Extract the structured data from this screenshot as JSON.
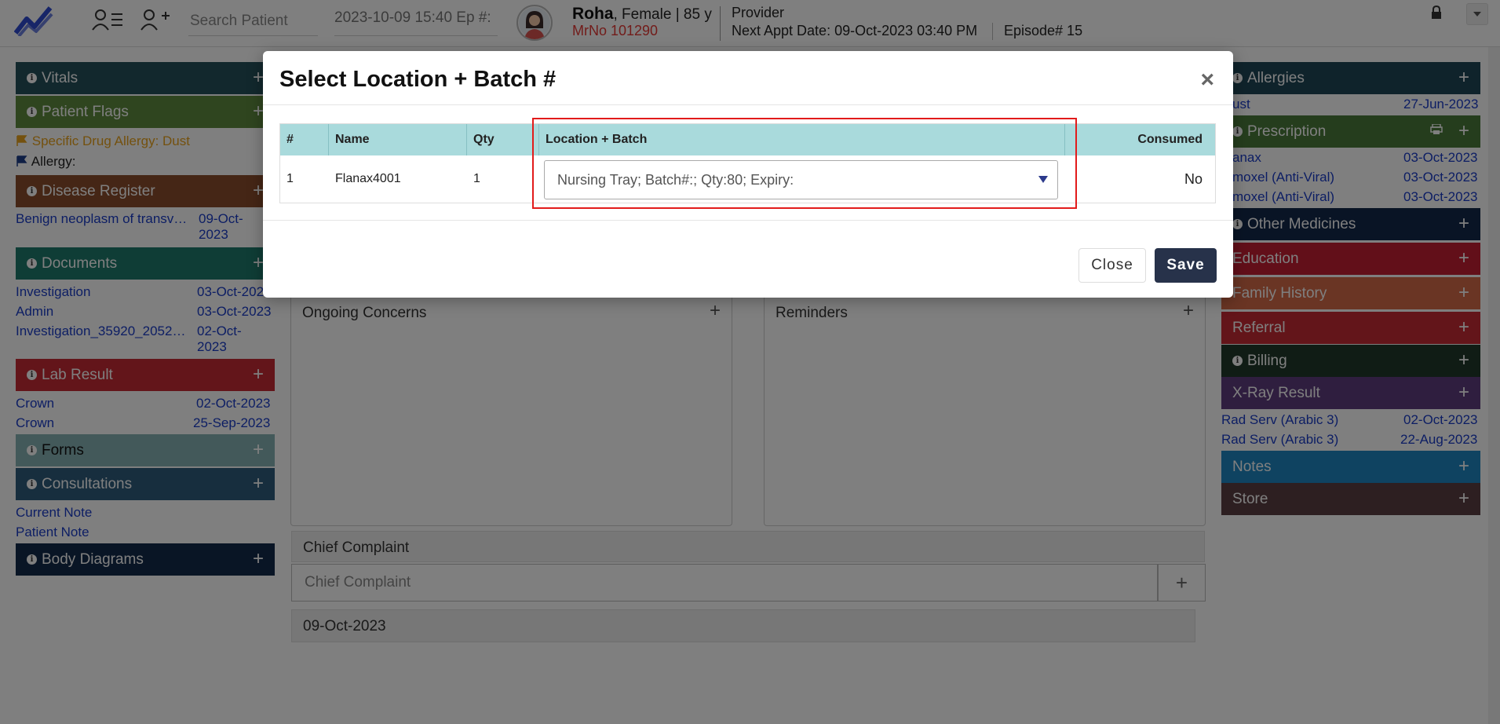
{
  "header": {
    "search_placeholder": "Search Patient",
    "datetime_episode": "2023-10-09 15:40 Ep #:",
    "patient_name": "Roha",
    "patient_meta": ", Female | 85 y",
    "mrno": "MrNo 101290",
    "provider": "Provider",
    "next_appt_label": "Next Appt Date",
    "next_appt_value": ": 09-Oct-2023 03:40 PM",
    "episode": "Episode# 15"
  },
  "left": {
    "vitals": "Vitals",
    "patient_flags": "Patient Flags",
    "flag_allergy_drug": "Specific Drug Allergy: Dust",
    "flag_allergy": "Allergy:",
    "disease_register": "Disease Register",
    "disease_item": "Benign neoplasm of transv…",
    "disease_date": "09-Oct-2023",
    "documents": "Documents",
    "doc_items": [
      {
        "name": "Investigation",
        "date": "03-Oct-2023"
      },
      {
        "name": "Admin",
        "date": "03-Oct-2023"
      },
      {
        "name": "Investigation_35920_2052…",
        "date": "02-Oct-2023"
      }
    ],
    "lab_result": "Lab Result",
    "lab_items": [
      {
        "name": "Crown",
        "date": "02-Oct-2023"
      },
      {
        "name": "Crown",
        "date": "25-Sep-2023"
      }
    ],
    "forms": "Forms",
    "consultations": "Consultations",
    "consult_items": [
      "Current Note",
      "Patient Note"
    ],
    "body_diagrams": "Body Diagrams"
  },
  "center": {
    "ongoing_concerns": "Ongoing Concerns",
    "reminders": "Reminders",
    "chief_complaint_label": "Chief Complaint",
    "chief_complaint_placeholder": "Chief Complaint",
    "date": "09-Oct-2023"
  },
  "right": {
    "allergies": "Allergies",
    "allergy_item": "ust",
    "allergy_date": "27-Jun-2023",
    "prescription": "Prescription",
    "rx_items": [
      {
        "name": "anax",
        "date": "03-Oct-2023"
      },
      {
        "name": "moxel (Anti-Viral)",
        "date": "03-Oct-2023"
      },
      {
        "name": "moxel (Anti-Viral)",
        "date": "03-Oct-2023"
      }
    ],
    "other_medicines": "Other Medicines",
    "education": "Education",
    "family_history": "Family History",
    "referral": "Referral",
    "billing": "Billing",
    "xray_result": "X-Ray Result",
    "xray_items": [
      {
        "name": "Rad Serv (Arabic 3)",
        "date": "02-Oct-2023"
      },
      {
        "name": "Rad Serv (Arabic 3)",
        "date": "22-Aug-2023"
      }
    ],
    "notes": "Notes",
    "store": "Store"
  },
  "modal": {
    "title": "Select Location + Batch #",
    "columns": [
      "#",
      "Name",
      "Qty",
      "Location + Batch",
      "Consumed"
    ],
    "row": {
      "num": "1",
      "name": "Flanax4001",
      "qty": "1",
      "location_batch": "Nursing Tray; Batch#:; Qty:80; Expiry:",
      "consumed": "No"
    },
    "close_label": "Close",
    "save_label": "Save"
  },
  "colors": {
    "vitals": "#24505a",
    "patient_flags": "#5f8a3e",
    "disease_register": "#8a4d2d",
    "documents": "#1f7a6c",
    "lab_result": "#c62a34",
    "forms": "#87b3b5",
    "consultations": "#2e5d7c",
    "body_diagrams": "#132a4a",
    "allergies": "#1e4757",
    "prescription": "#4b7a3a",
    "other_medicines": "#13284b",
    "education": "#c41f33",
    "family_history": "#d46a49",
    "referral": "#c72a34",
    "billing": "#20392b",
    "xray_result": "#5e3d7f",
    "notes": "#1e86c2",
    "store": "#5a3f42",
    "save_button": "#27324a",
    "highlight": "#e21b1b"
  }
}
